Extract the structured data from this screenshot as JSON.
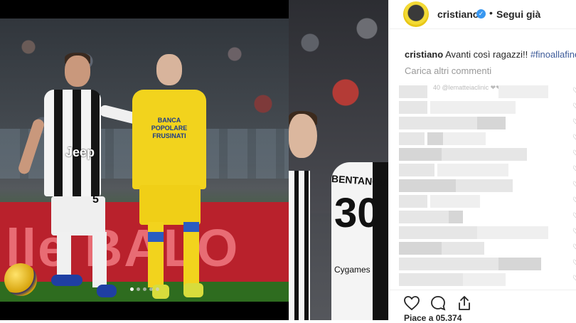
{
  "post": {
    "author": {
      "username": "cristiano",
      "verified": true,
      "follow_label": "Segui già",
      "separator": "•"
    },
    "caption": {
      "username": "cristiano",
      "text": "Avanti così ragazzi!!",
      "hashtag": "#finoallafine"
    },
    "load_more_label": "Carica altri commenti",
    "comments_partial_text": "40 @lematteiaclinic ❤❤❤",
    "likes_partial": "Piace a 05.374",
    "media": {
      "carousel_total": 5,
      "carousel_active_index": 0,
      "photo1": {
        "ad_text": "lle BALO",
        "jersey_sponsor": "Jeep",
        "jersey_number": "5",
        "opponent_sponsor": "BANCA POPOLARE FRUSINATI"
      },
      "photo2": {
        "shirt_name": "BENTANCUR",
        "shirt_number": "30",
        "shirt_sponsor": "Cygames"
      }
    },
    "actions": {
      "like": "heart-icon",
      "comment": "comment-icon",
      "share": "share-icon"
    },
    "colors": {
      "link": "#3c5a99",
      "verified": "#3897f0",
      "text": "#262626",
      "muted": "#999999"
    }
  }
}
